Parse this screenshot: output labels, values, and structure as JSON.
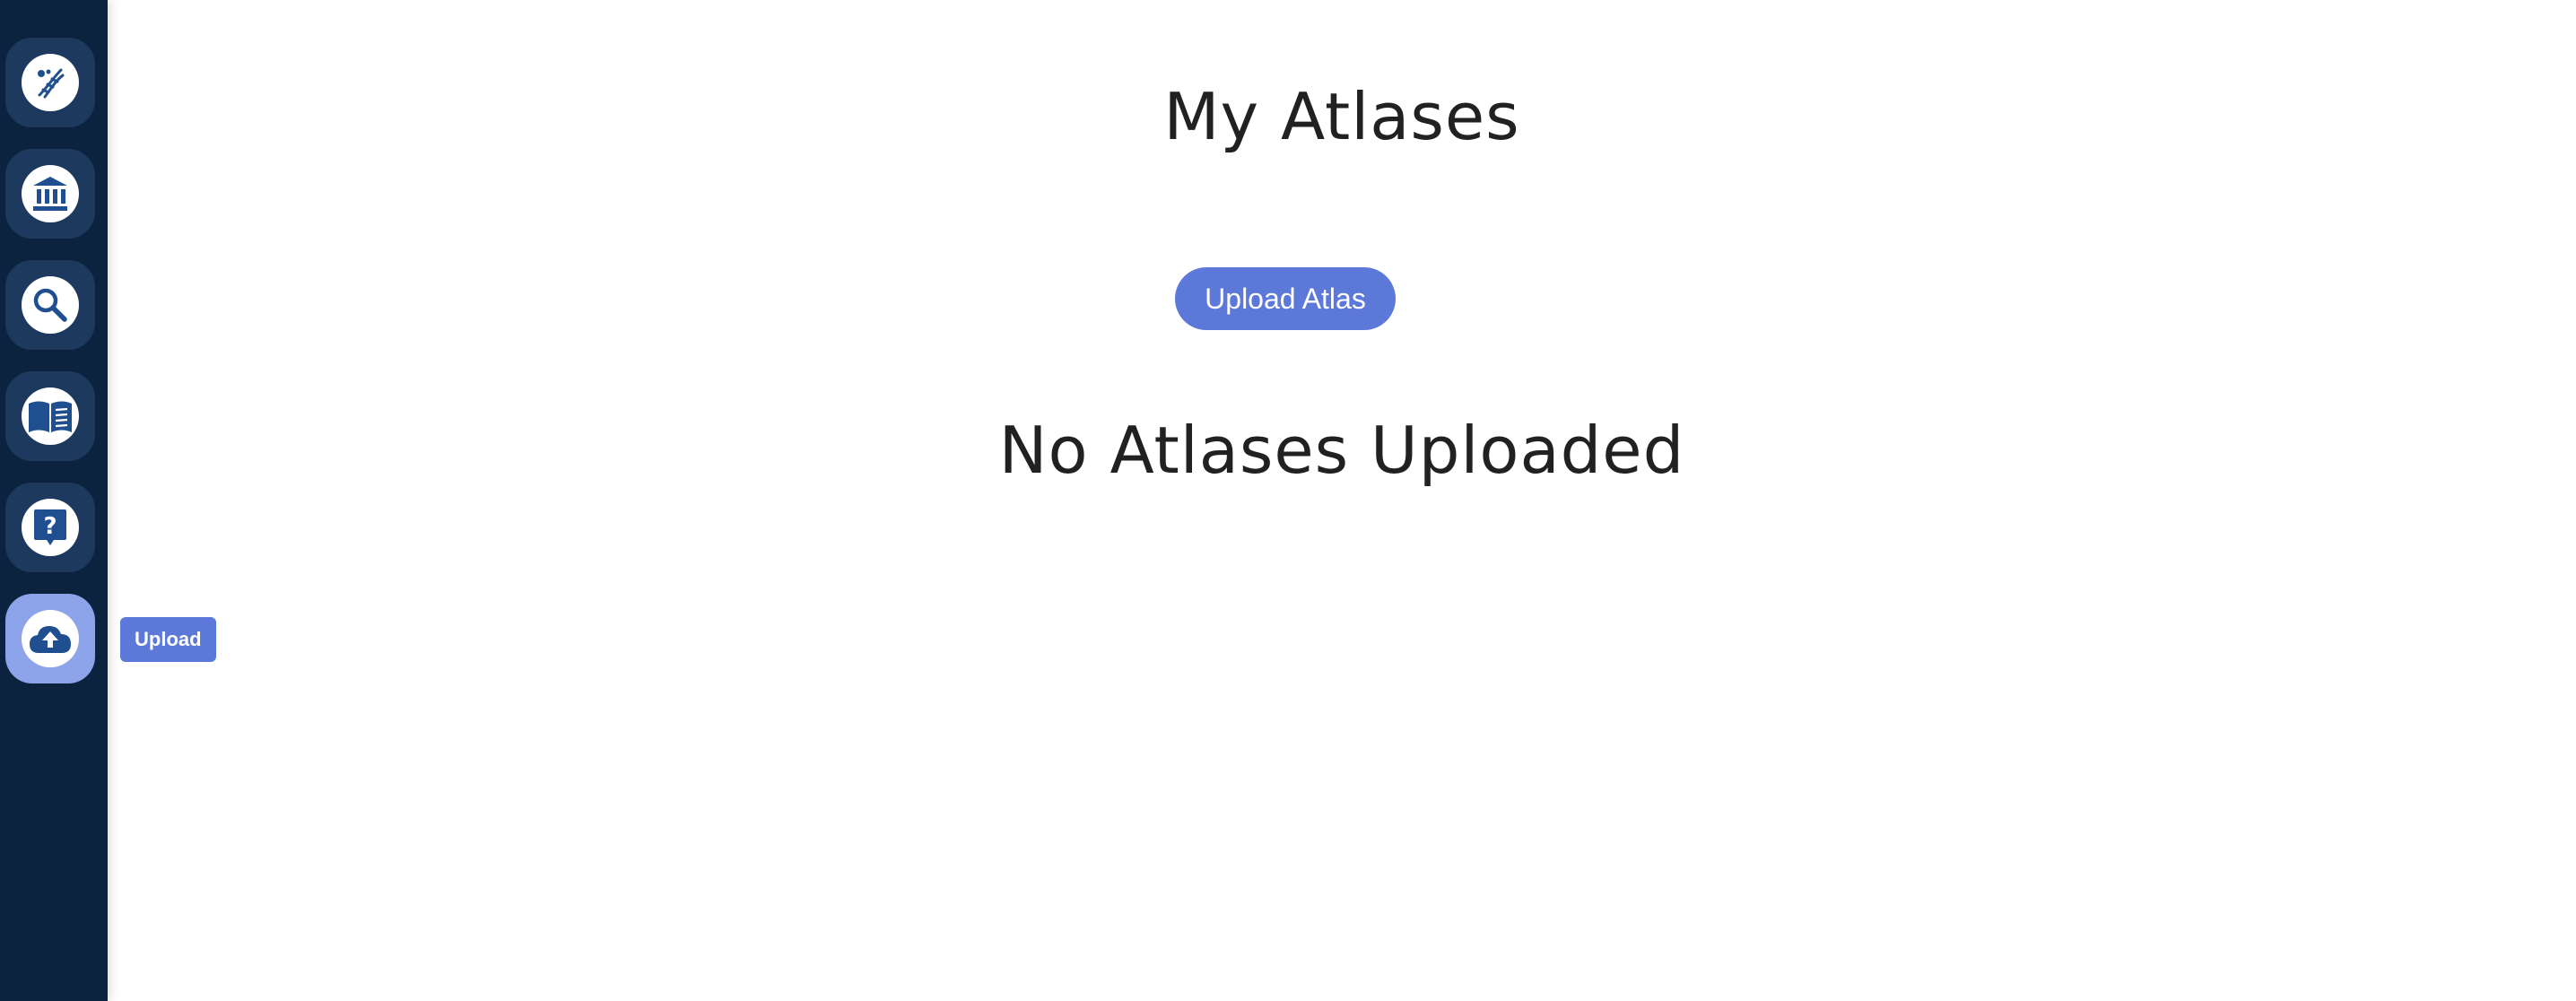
{
  "sidebar": {
    "items": [
      {
        "name": "dna-icon",
        "label": "Atlas",
        "active": false
      },
      {
        "name": "museum-icon",
        "label": "Library",
        "active": false
      },
      {
        "name": "search-icon",
        "label": "Search",
        "active": false
      },
      {
        "name": "book-icon",
        "label": "Docs",
        "active": false
      },
      {
        "name": "help-icon",
        "label": "Help",
        "active": false
      },
      {
        "name": "cloud-upload-icon",
        "label": "Upload",
        "active": true
      }
    ],
    "tooltip": "Upload"
  },
  "main": {
    "title": "My Atlases",
    "upload_button_label": "Upload Atlas",
    "empty_message": "No Atlases Uploaded"
  },
  "colors": {
    "sidebar_bg": "#0c2340",
    "nav_item_bg": "#1d3a5e",
    "nav_active_bg": "#8ea4ea",
    "accent": "#5c78d9",
    "icon_color": "#1f4f8f"
  }
}
